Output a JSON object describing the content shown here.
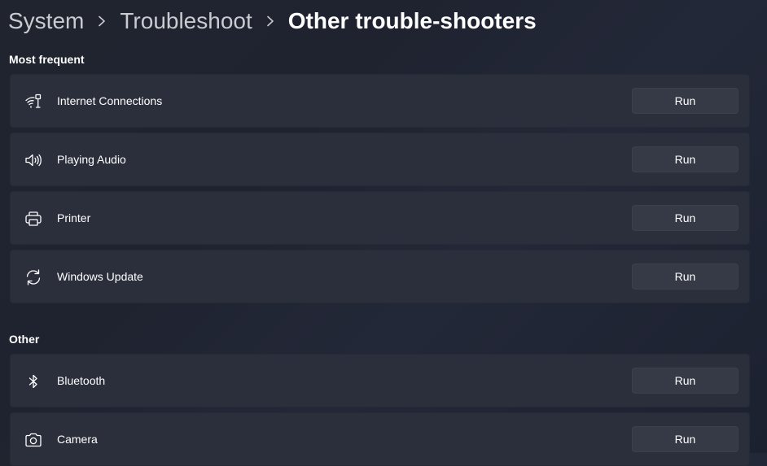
{
  "breadcrumb": {
    "items": [
      "System",
      "Troubleshoot",
      "Other trouble-shooters"
    ]
  },
  "sections": {
    "most_frequent": {
      "title": "Most frequent",
      "items": [
        {
          "label": "Internet Connections",
          "icon": "wifi-ethernet-icon",
          "button": "Run"
        },
        {
          "label": "Playing Audio",
          "icon": "speaker-icon",
          "button": "Run"
        },
        {
          "label": "Printer",
          "icon": "printer-icon",
          "button": "Run"
        },
        {
          "label": "Windows Update",
          "icon": "sync-icon",
          "button": "Run"
        }
      ]
    },
    "other": {
      "title": "Other",
      "items": [
        {
          "label": "Bluetooth",
          "icon": "bluetooth-icon",
          "button": "Run"
        },
        {
          "label": "Camera",
          "icon": "camera-icon",
          "button": "Run"
        }
      ]
    }
  },
  "colors": {
    "background": "#20242f",
    "card": "#2b2f3b",
    "button": "#363a46",
    "text": "#ffffff",
    "breadcrumb_inactive": "#c9cbd0"
  }
}
